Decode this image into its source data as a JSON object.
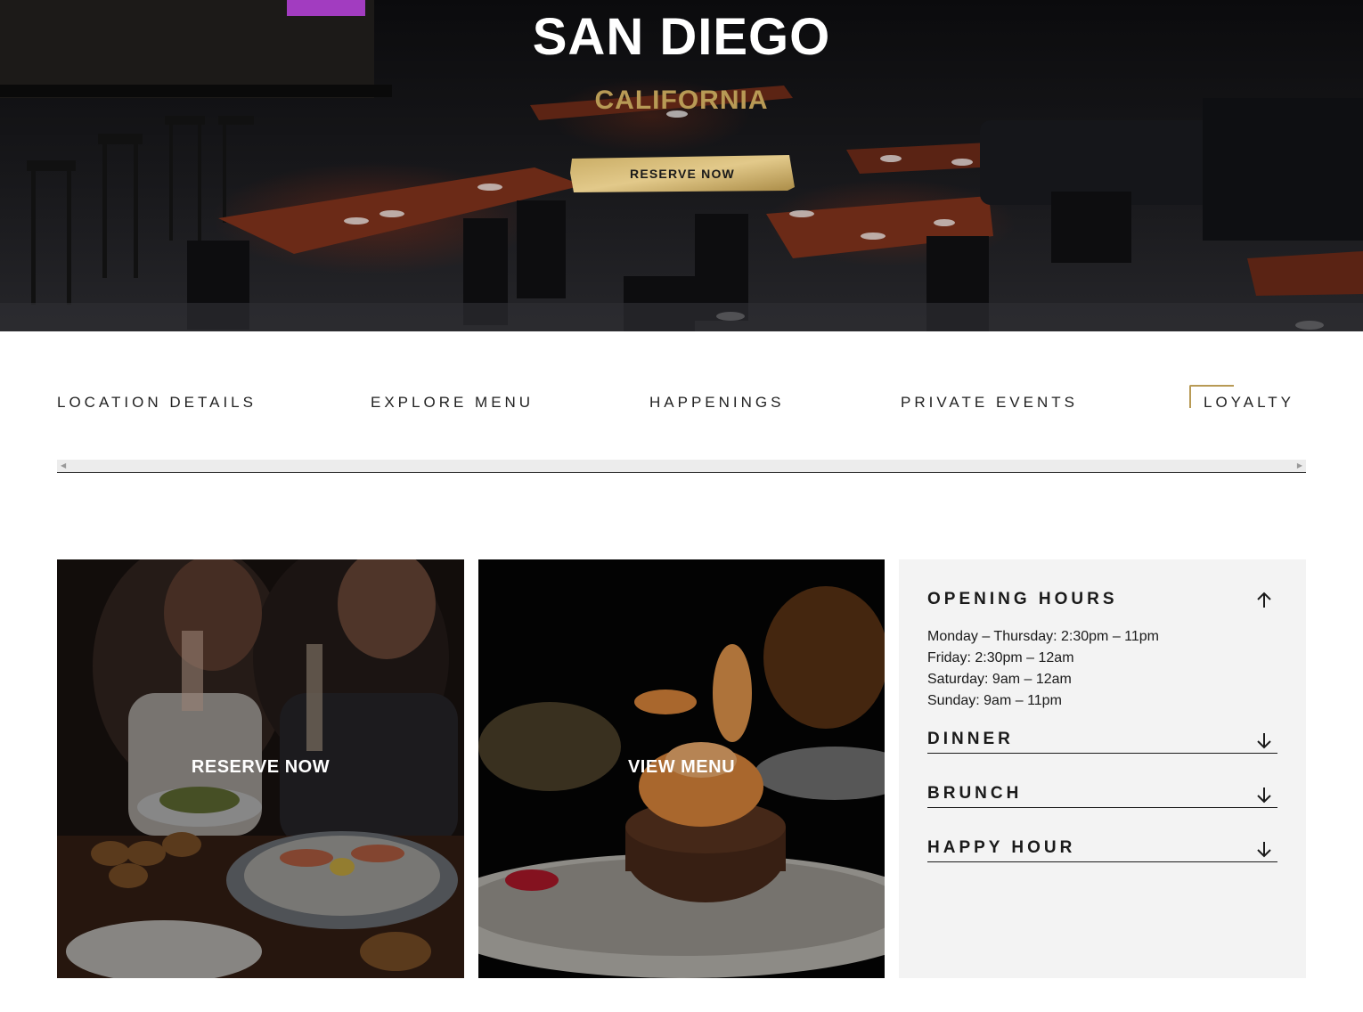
{
  "hero": {
    "title": "SAN DIEGO",
    "subtitle": "CALIFORNIA",
    "cta_label": "RESERVE NOW"
  },
  "nav": {
    "items": [
      "LOCATION DETAILS",
      "EXPLORE MENU",
      "HAPPENINGS",
      "PRIVATE EVENTS",
      "LOYALTY"
    ]
  },
  "cards": {
    "reserve_label": "RESERVE NOW",
    "menu_label": "VIEW MENU"
  },
  "hours": {
    "title": "OPENING HOURS",
    "lines": [
      "Monday – Thursday: 2:30pm – 11pm",
      "Friday: 2:30pm – 12am",
      "Saturday: 9am – 12am",
      "Sunday: 9am – 11pm"
    ],
    "sections": [
      "DINNER",
      "BRUNCH",
      "HAPPY HOUR"
    ]
  },
  "colors": {
    "accent_gold": "#b89a55",
    "panel_bg": "#f3f3f3",
    "text_dark": "#1a1a1a"
  },
  "icons": {
    "expanded": "arrow-up-icon",
    "collapsed": "arrow-down-icon"
  }
}
